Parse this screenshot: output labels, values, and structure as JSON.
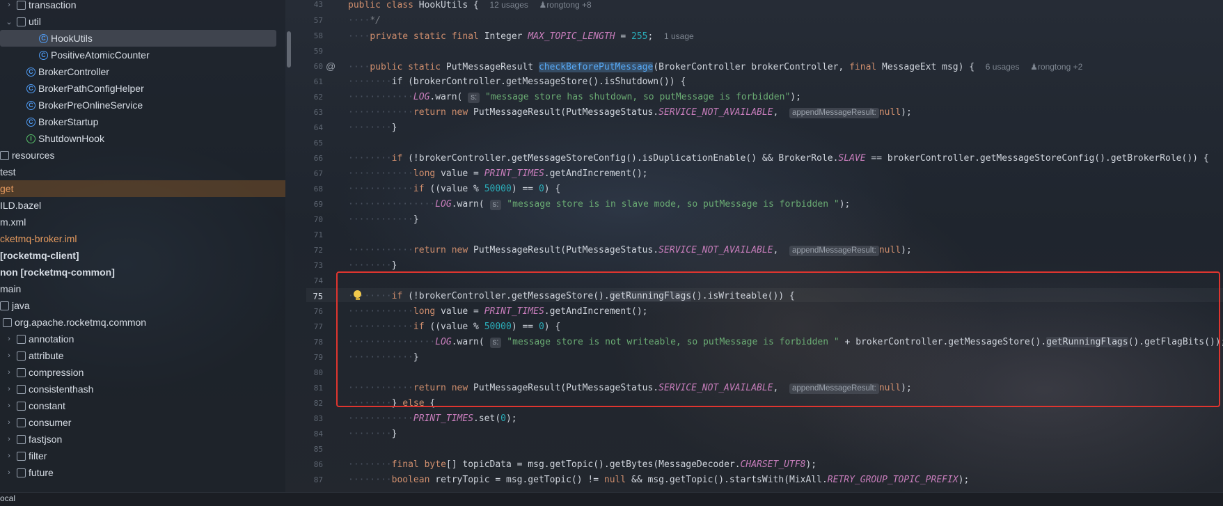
{
  "tree": {
    "items": [
      {
        "label": "transaction",
        "icon": "folder-icon",
        "chev": "›"
      },
      {
        "label": "util",
        "icon": "folder-icon",
        "chev": "⌄"
      },
      {
        "label": "HookUtils",
        "icon": "class-icon",
        "chev": ""
      },
      {
        "label": "PositiveAtomicCounter",
        "icon": "class-icon",
        "chev": ""
      },
      {
        "label": "BrokerController",
        "icon": "class-icon",
        "chev": ""
      },
      {
        "label": "BrokerPathConfigHelper",
        "icon": "class-icon",
        "chev": ""
      },
      {
        "label": "BrokerPreOnlineService",
        "icon": "class-icon",
        "chev": ""
      },
      {
        "label": "BrokerStartup",
        "icon": "class-icon",
        "chev": ""
      },
      {
        "label": "ShutdownHook",
        "icon": "interface-icon",
        "chev": ""
      },
      {
        "label": "resources",
        "icon": "folder-icon",
        "chev": ""
      },
      {
        "label": "test",
        "icon": "",
        "chev": ""
      },
      {
        "label": "get",
        "icon": "",
        "chev": ""
      },
      {
        "label": "ILD.bazel",
        "icon": "",
        "chev": ""
      },
      {
        "label": "m.xml",
        "icon": "",
        "chev": ""
      },
      {
        "label": "cketmq-broker.iml",
        "icon": "",
        "chev": ""
      },
      {
        "label": "[rocketmq-client]",
        "icon": "",
        "chev": ""
      },
      {
        "label": "non [rocketmq-common]",
        "icon": "",
        "chev": ""
      },
      {
        "label": "main",
        "icon": "",
        "chev": ""
      },
      {
        "label": "java",
        "icon": "folder-icon",
        "chev": ""
      },
      {
        "label": "org.apache.rocketmq.common",
        "icon": "folder-icon",
        "chev": "⌄"
      },
      {
        "label": "annotation",
        "icon": "folder-icon",
        "chev": "›"
      },
      {
        "label": "attribute",
        "icon": "folder-icon",
        "chev": "›"
      },
      {
        "label": "compression",
        "icon": "folder-icon",
        "chev": "›"
      },
      {
        "label": "consistenthash",
        "icon": "folder-icon",
        "chev": "›"
      },
      {
        "label": "constant",
        "icon": "folder-icon",
        "chev": "›"
      },
      {
        "label": "consumer",
        "icon": "folder-icon",
        "chev": "›"
      },
      {
        "label": "fastjson",
        "icon": "folder-icon",
        "chev": "›"
      },
      {
        "label": "filter",
        "icon": "folder-icon",
        "chev": "›"
      },
      {
        "label": "future",
        "icon": "folder-icon",
        "chev": "›"
      }
    ]
  },
  "editor": {
    "line_numbers": [
      "43",
      "57",
      "58",
      "59",
      "60",
      "61",
      "62",
      "63",
      "64",
      "65",
      "66",
      "67",
      "68",
      "69",
      "70",
      "71",
      "72",
      "73",
      "74",
      "75",
      "76",
      "77",
      "78",
      "79",
      "80",
      "81",
      "82",
      "83",
      "84",
      "85",
      "86",
      "87"
    ],
    "class_decl": {
      "prefix": "public class ",
      "name": "HookUtils {",
      "usages": "12 usages",
      "author": "rongtong +8"
    },
    "comment_end": "*/",
    "field_line": {
      "mods": "private static final ",
      "type": "Integer ",
      "name": "MAX_TOPIC_LENGTH",
      "eq": " = ",
      "val": "255",
      "semi": ";",
      "usages": "1 usage"
    },
    "method_decl": {
      "mods": "public static ",
      "ret": "PutMessageResult ",
      "name": "checkBeforePutMessage",
      "params": "(BrokerController brokerController, ",
      "final_kw": "final",
      "params2": " MessageExt msg) {",
      "usages": "6 usages",
      "author": "rongtong +2"
    },
    "l61": "if (brokerController.getMessageStore().isShutdown()) {",
    "l62": {
      "log": "LOG",
      "pre": ".warn(",
      "hint": "s:",
      "str": "\"message store has shutdown, so putMessage is forbidden\"",
      "post": ");"
    },
    "ret_line": {
      "ret": "return ",
      "new": "new ",
      "cls": "PutMessageResult(PutMessageStatus.",
      "status": "SERVICE_NOT_AVAILABLE",
      "comma": ",",
      "hint": "appendMessageResult:",
      "null": "null",
      "end": ");"
    },
    "close_brace": "}",
    "l66": {
      "if": "if ",
      "a": "(!brokerController.getMessageStoreConfig().isDuplicationEnable() && BrokerRole.",
      "slave": "SLAVE",
      "b": " == brokerController.getMessageStoreConfig().getBrokerRole()) {"
    },
    "l67": {
      "long": "long ",
      "a": "value = ",
      "pt": "PRINT_TIMES",
      "b": ".getAndIncrement();"
    },
    "l68": {
      "if": "if ",
      "a": "((value % ",
      "num": "50000",
      "b": ") == ",
      "zero": "0",
      "c": ") {"
    },
    "l69": {
      "log": "LOG",
      "pre": ".warn(",
      "hint": "s:",
      "str": "\"message store is in slave mode, so putMessage is forbidden \"",
      "post": ");"
    },
    "l75": {
      "if": "if ",
      "a": "(!brokerController.getMessageStore().",
      "rf": "getRunningFlags",
      "b": "().isWriteable()) {"
    },
    "l78": {
      "log": "LOG",
      "pre": ".warn(",
      "hint": "s:",
      "str": "\"message store is not writeable, so putMessage is forbidden \"",
      "a": " + brokerController.getMessageStore().",
      "rf": "getRunningFlags",
      "b": "().getFlagBits());"
    },
    "l82": {
      "a": "} ",
      "else": "else",
      "b": " {"
    },
    "l83": {
      "pt": "PRINT_TIMES",
      "a": ".set(",
      "zero": "0",
      "b": ");"
    },
    "l86": {
      "final": "final ",
      "byte": "byte",
      "a": "[] topicData = msg.getTopic().getBytes(MessageDecoder.",
      "cs": "CHARSET_UTF8",
      "b": ");"
    },
    "l87": {
      "bool": "boolean ",
      "a": "retryTopic = msg.getTopic() != ",
      "null": "null",
      "b": " && msg.getTopic().startsWith(MixAll.",
      "rp": "RETRY_GROUP_TOPIC_PREFIX",
      "c": ");"
    }
  },
  "status_bar": {
    "text": "ocal"
  },
  "colors": {
    "highlight_box": "#e0352f",
    "keyword": "#cf8e6d",
    "field": "#c77dbb",
    "string": "#6aab73",
    "number": "#2aacb8"
  }
}
